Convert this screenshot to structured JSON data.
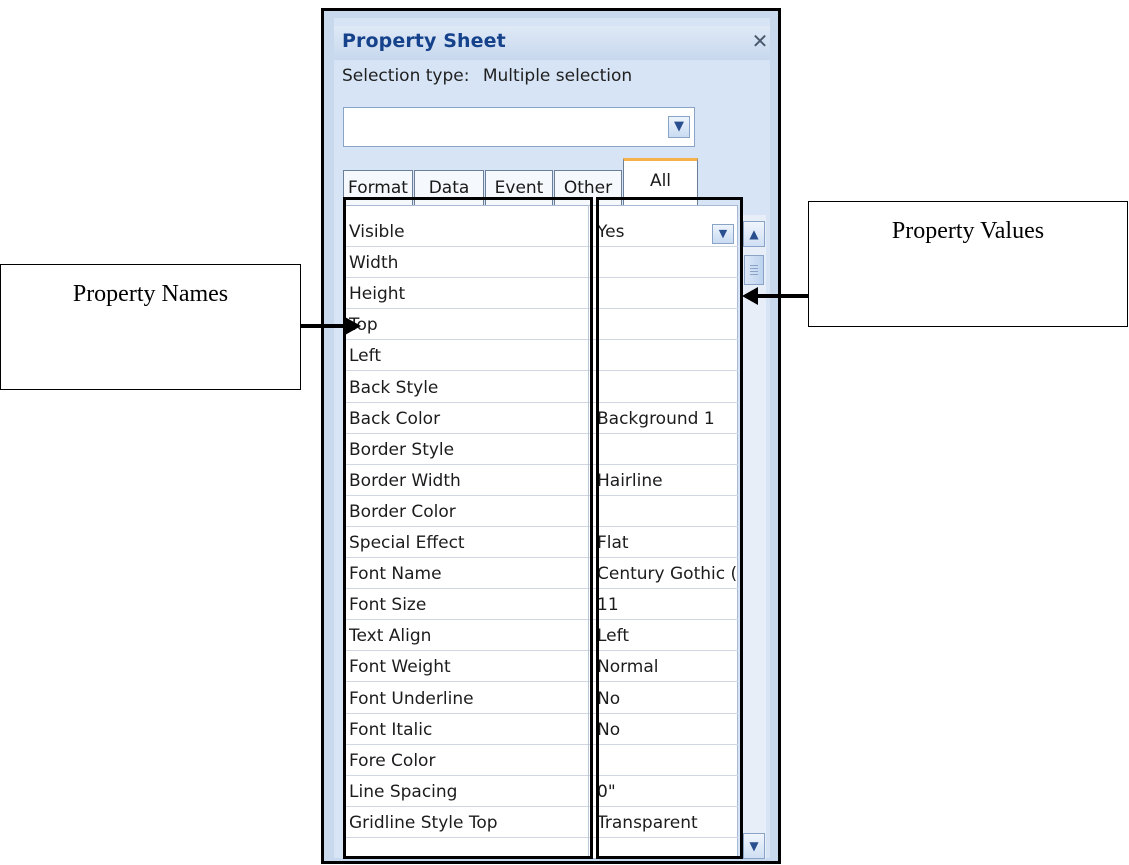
{
  "panel": {
    "title": "Property Sheet",
    "close_glyph": "✕",
    "selection_type_label": "Selection type:",
    "selection_type_value": "Multiple selection",
    "combo_value": "",
    "tabs": [
      {
        "label": "Format",
        "active": false
      },
      {
        "label": "Data",
        "active": false
      },
      {
        "label": "Event",
        "active": false
      },
      {
        "label": "Other",
        "active": false
      },
      {
        "label": "All",
        "active": true
      }
    ]
  },
  "properties": [
    {
      "name": "Visible",
      "value": "Yes"
    },
    {
      "name": "Width",
      "value": ""
    },
    {
      "name": "Height",
      "value": ""
    },
    {
      "name": "Top",
      "value": ""
    },
    {
      "name": "Left",
      "value": ""
    },
    {
      "name": "Back Style",
      "value": ""
    },
    {
      "name": "Back Color",
      "value": "Background 1"
    },
    {
      "name": "Border Style",
      "value": ""
    },
    {
      "name": "Border Width",
      "value": "Hairline"
    },
    {
      "name": "Border Color",
      "value": ""
    },
    {
      "name": "Special Effect",
      "value": "Flat"
    },
    {
      "name": "Font Name",
      "value": "Century Gothic ("
    },
    {
      "name": "Font Size",
      "value": "11"
    },
    {
      "name": "Text Align",
      "value": "Left"
    },
    {
      "name": "Font Weight",
      "value": "Normal"
    },
    {
      "name": "Font Underline",
      "value": "No"
    },
    {
      "name": "Font Italic",
      "value": "No"
    },
    {
      "name": "Fore Color",
      "value": ""
    },
    {
      "name": "Line Spacing",
      "value": "0\""
    },
    {
      "name": "Gridline Style Top",
      "value": "Transparent"
    }
  ],
  "callouts": {
    "names": "Property Names",
    "values": "Property Values"
  }
}
